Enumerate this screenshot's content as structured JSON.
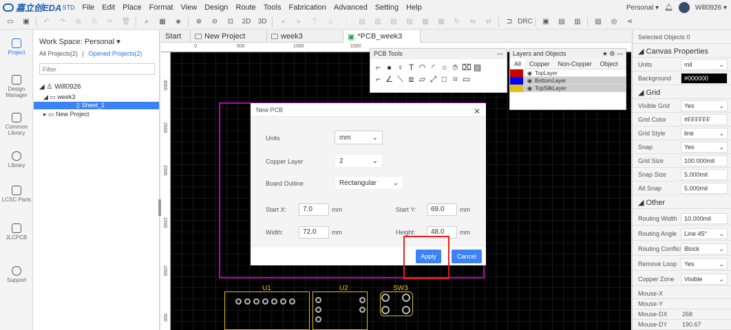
{
  "app": {
    "logo_text": "嘉立创EDA",
    "edition": "STD"
  },
  "menu": [
    "File",
    "Edit",
    "Place",
    "Format",
    "View",
    "Design",
    "Route",
    "Tools",
    "Fabrication",
    "Advanced",
    "Setting",
    "Help"
  ],
  "account": {
    "personal": "Personal ▾",
    "user": "Will0926 ▾"
  },
  "sidebar": [
    {
      "label": "Project",
      "icon": "folder-icon",
      "active": true
    },
    {
      "label": "Design Manager",
      "icon": "list-icon",
      "active": false
    },
    {
      "label": "Common Library",
      "icon": "chip-icon",
      "active": false
    },
    {
      "label": "Library",
      "icon": "search-icon",
      "active": false
    },
    {
      "label": "LCSC Parts",
      "icon": "lcsc-icon",
      "active": false
    },
    {
      "label": "JLCPCB",
      "icon": "jlcpcb-icon",
      "active": false
    },
    {
      "label": "Support",
      "icon": "help-icon",
      "active": false
    }
  ],
  "panel": {
    "workspace": "Work Space: Personal ▾",
    "all_projects": "All Projects(2)",
    "separator": "|",
    "opened_projects": "Opened Projects(2)",
    "filter_placeholder": "Filter",
    "tree": {
      "user": "Will0926",
      "project1": "week3",
      "sheet": "Sheet_1",
      "project2": "New Project"
    }
  },
  "tabs": [
    "Start",
    "New Project",
    "week3",
    "*PCB_week3"
  ],
  "rulers": {
    "top": [
      "0",
      "500",
      "1000",
      "1500"
    ],
    "left": [
      "3000",
      "2500",
      "2000",
      "1500",
      "1000",
      "500"
    ]
  },
  "pcb_tools": {
    "title": "PCB Tools"
  },
  "layers": {
    "title": "Layers and Objects",
    "tabs": [
      "All",
      "Copper",
      "Non-Copper",
      "Object"
    ],
    "rows": [
      {
        "name": "TopLayer",
        "color": "#cc0000"
      },
      {
        "name": "BottomLayer",
        "color": "#0000ff"
      },
      {
        "name": "TopSilkLayer",
        "color": "#e0c020"
      }
    ]
  },
  "components": {
    "u1": "U1",
    "u2": "U2",
    "sw3": "SW3"
  },
  "dialog": {
    "title": "New PCB",
    "units_label": "Units",
    "units_value": "mm",
    "copper_label": "Copper Layer",
    "copper_value": "2",
    "outline_label": "Board Outline",
    "outline_value": "Rectangular",
    "startx_label": "Start X:",
    "startx_value": "7.0",
    "starty_label": "Start Y:",
    "starty_value": "69.0",
    "width_label": "Width:",
    "width_value": "72.0",
    "height_label": "Height:",
    "height_value": "48.0",
    "unit": "mm",
    "apply": "Apply",
    "cancel": "Cancel"
  },
  "props": {
    "selected": "Selected Objects   0",
    "canvas_section": "Canvas Properties",
    "units": {
      "k": "Units",
      "v": "mil"
    },
    "background": {
      "k": "Background",
      "v": "#000000"
    },
    "grid_section": "Grid",
    "visible_grid": {
      "k": "Visible Grid",
      "v": "Yes"
    },
    "grid_color": {
      "k": "Grid Color",
      "v": "#FFFFFF"
    },
    "grid_style": {
      "k": "Grid Style",
      "v": "line"
    },
    "snap": {
      "k": "Snap",
      "v": "Yes"
    },
    "grid_size": {
      "k": "Grid Size",
      "v": "100.000mil"
    },
    "snap_size": {
      "k": "Snap Size",
      "v": "5.000mil"
    },
    "alt_snap": {
      "k": "Alt Snap",
      "v": "5.000mil"
    },
    "other_section": "Other",
    "routing_width": {
      "k": "Routing Width",
      "v": "10.000mil"
    },
    "routing_angle": {
      "k": "Routing Angle",
      "v": "Line 45°"
    },
    "routing_conflict": {
      "k": "Routing Conflict",
      "v": "Block"
    },
    "remove_loop": {
      "k": "Remove Loop",
      "v": "Yes"
    },
    "copper_zone": {
      "k": "Copper Zone",
      "v": "Visible"
    },
    "mouse_x": {
      "k": "Mouse-X",
      "v": ""
    },
    "mouse_y": {
      "k": "Mouse-Y",
      "v": ""
    },
    "mouse_dx": {
      "k": "Mouse-DX",
      "v": "268"
    },
    "mouse_dy": {
      "k": "Mouse-DY",
      "v": "190.67"
    }
  }
}
